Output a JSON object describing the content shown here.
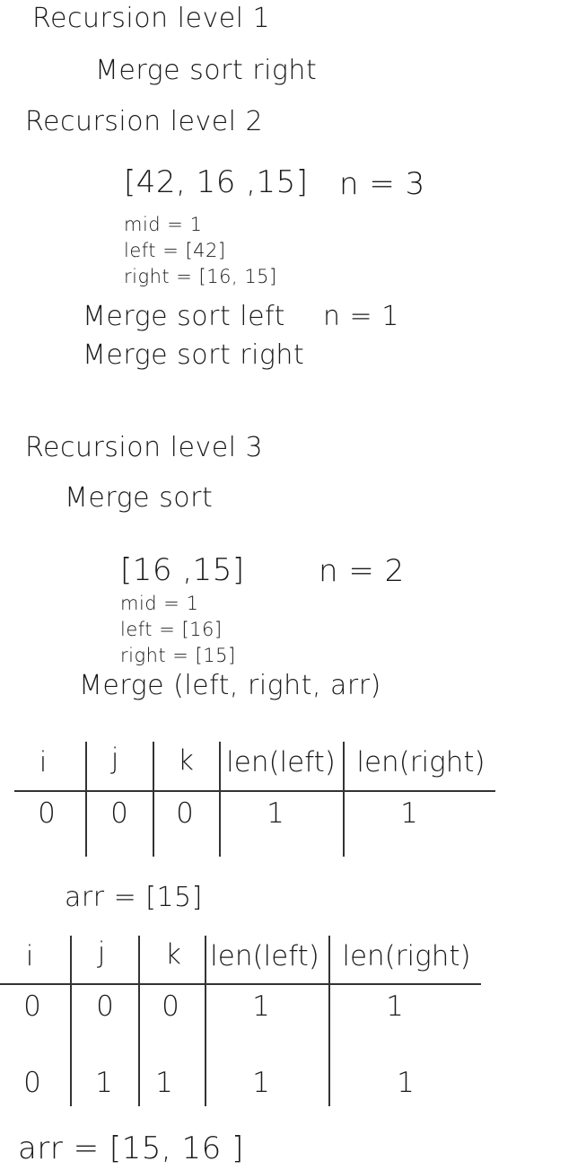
{
  "sections": {
    "level1": {
      "heading": "Recursion level 1",
      "step": "Merge sort right"
    },
    "level2": {
      "heading": "Recursion level 2",
      "array": "[42, 16 ,15]",
      "n": "n = 3",
      "mid": "mid = 1",
      "left": "left = [42]",
      "right": "right = [16, 15]",
      "step_left": "Merge sort left",
      "n_left": "n = 1",
      "step_right": "Merge sort right"
    },
    "level3": {
      "heading": "Recursion level 3",
      "step": "Merge sort",
      "array": "[16 ,15]",
      "n": "n = 2",
      "mid": "mid = 1",
      "left": "left = [16]",
      "right": "right = [15]",
      "merge_call": "Merge (left, right, arr)"
    }
  },
  "table1": {
    "headers": [
      "i",
      "j",
      "k",
      "len(left)",
      "len(right)"
    ],
    "rows": [
      [
        "0",
        "0",
        "0",
        "1",
        "1"
      ]
    ]
  },
  "arr_after_table1": "arr = [15]",
  "table2": {
    "headers": [
      "i",
      "j",
      "k",
      "len(left)",
      "len(right)"
    ],
    "rows": [
      [
        "0",
        "0",
        "0",
        "1",
        "1"
      ],
      [
        "0",
        "1",
        "1",
        "1",
        "1"
      ]
    ]
  },
  "arr_final": "arr = [15, 16 ]"
}
